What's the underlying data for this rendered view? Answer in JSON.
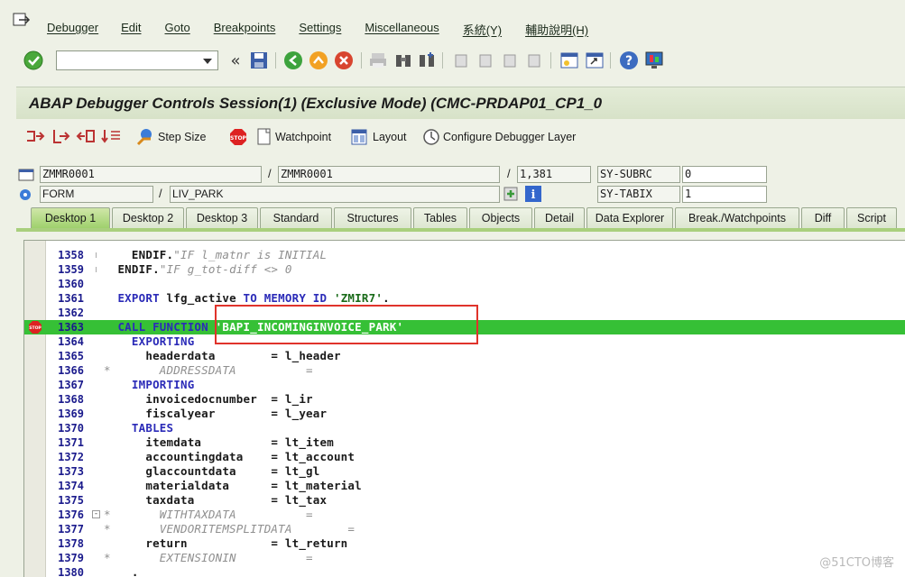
{
  "menu": {
    "items": [
      "Debugger",
      "Edit",
      "Goto",
      "Breakpoints",
      "Settings",
      "Miscellaneous",
      "系統(Y)",
      "輔助說明(H)"
    ]
  },
  "toolbar": {
    "command_field": {
      "value": "",
      "placeholder": ""
    }
  },
  "window": {
    "title": "ABAP Debugger Controls Session(1)  (Exclusive Mode) (CMC-PRDAP01_CP1_0"
  },
  "app_toolbar": {
    "step_size": "Step Size",
    "watchpoint": "Watchpoint",
    "layout": "Layout",
    "configure": "Configure Debugger Layer"
  },
  "status": {
    "program": "ZMMR0001",
    "include": "ZMMR0001",
    "line": "1,381",
    "block_type": "FORM",
    "block_name": "LIV_PARK",
    "sy_subrc_label": "SY-SUBRC",
    "sy_subrc_value": "0",
    "sy_tabix_label": "SY-TABIX",
    "sy_tabix_value": "1"
  },
  "tabs": [
    "Desktop 1",
    "Desktop 2",
    "Desktop 3",
    "Standard",
    "Structures",
    "Tables",
    "Objects",
    "Detail",
    "Data Explorer",
    "Break./Watchpoints",
    "Diff",
    "Script"
  ],
  "active_tab": "Desktop 1",
  "code": {
    "lines": [
      {
        "n": "1358",
        "t": "    ENDIF.",
        "c": "\"IF l_matnr is INITIAL"
      },
      {
        "n": "1359",
        "t": "  ENDIF.",
        "c": "\"IF g_tot-diff <> 0"
      },
      {
        "n": "1360",
        "t": ""
      },
      {
        "n": "1361",
        "t": "  EXPORT lfg_active TO MEMORY ID 'ZMIR7'."
      },
      {
        "n": "1362",
        "t": ""
      },
      {
        "n": "1363",
        "t": "  CALL FUNCTION 'BAPI_INCOMINGINVOICE_PARK'"
      },
      {
        "n": "1364",
        "t": "    EXPORTING"
      },
      {
        "n": "1365",
        "t": "      headerdata        = l_header"
      },
      {
        "n": "1366",
        "t": "",
        "c": "*       ADDRESSDATA          ="
      },
      {
        "n": "1367",
        "t": "    IMPORTING"
      },
      {
        "n": "1368",
        "t": "      invoicedocnumber  = l_ir"
      },
      {
        "n": "1369",
        "t": "      fiscalyear        = l_year"
      },
      {
        "n": "1370",
        "t": "    TABLES"
      },
      {
        "n": "1371",
        "t": "      itemdata          = lt_item"
      },
      {
        "n": "1372",
        "t": "      accountingdata    = lt_account"
      },
      {
        "n": "1373",
        "t": "      glaccountdata     = lt_gl"
      },
      {
        "n": "1374",
        "t": "      materialdata      = lt_material"
      },
      {
        "n": "1375",
        "t": "      taxdata           = lt_tax"
      },
      {
        "n": "1376",
        "t": "",
        "c": "*       WITHTAXDATA          ="
      },
      {
        "n": "1377",
        "t": "",
        "c": "*       VENDORITEMSPLITDATA        ="
      },
      {
        "n": "1378",
        "t": "      return            = lt_return"
      },
      {
        "n": "1379",
        "t": "",
        "c": "*       EXTENSIONIN          ="
      },
      {
        "n": "1380",
        "t": "    ."
      }
    ],
    "current_line": "1363"
  },
  "watermark": "@51CTO博客",
  "colors": {
    "current_line": "#36c036",
    "highlight_box": "#e0332b",
    "active_tab": "#9dd06a"
  }
}
